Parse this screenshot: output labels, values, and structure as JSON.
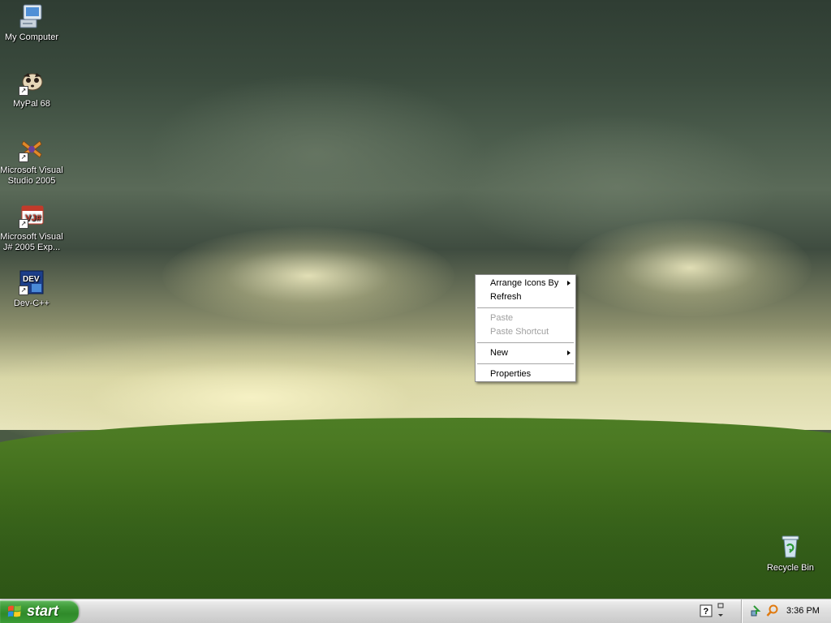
{
  "desktop": {
    "icons": [
      {
        "label": "My Computer",
        "icon": "my-computer-icon"
      },
      {
        "label": "MyPal 68",
        "icon": "mypal-icon"
      },
      {
        "label": "Microsoft Visual Studio 2005",
        "icon": "visual-studio-icon"
      },
      {
        "label": "Microsoft Visual J# 2005 Exp...",
        "icon": "visual-jsharp-icon"
      },
      {
        "label": "Dev-C++",
        "icon": "devcpp-icon"
      },
      {
        "label": "Recycle Bin",
        "icon": "recycle-bin-icon"
      }
    ]
  },
  "context_menu": {
    "items": [
      {
        "label": "Arrange Icons By",
        "submenu": true,
        "enabled": true
      },
      {
        "label": "Refresh",
        "submenu": false,
        "enabled": true
      },
      {
        "label": "Paste",
        "submenu": false,
        "enabled": false
      },
      {
        "label": "Paste Shortcut",
        "submenu": false,
        "enabled": false
      },
      {
        "label": "New",
        "submenu": true,
        "enabled": true
      },
      {
        "label": "Properties",
        "submenu": false,
        "enabled": true
      }
    ]
  },
  "taskbar": {
    "start_label": "start",
    "clock": "3:36 PM",
    "quick_icons": [
      "help-icon",
      "taskbar-toggle-icon"
    ],
    "tray_icons": [
      "network-icon",
      "search-icon"
    ]
  },
  "colors": {
    "start_green": "#3f9b39",
    "menu_disabled": "#a0a0a0"
  }
}
